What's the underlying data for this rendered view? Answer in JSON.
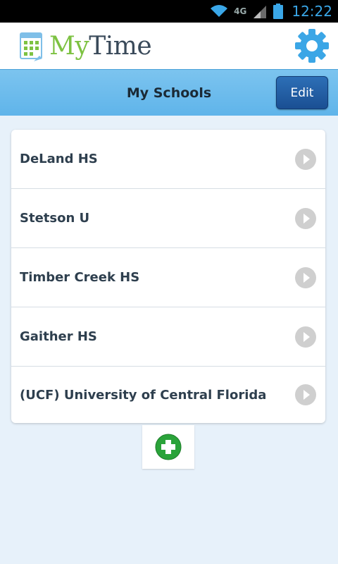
{
  "status_bar": {
    "time": "12:22",
    "network": "4G"
  },
  "app": {
    "logo_my": "My",
    "logo_time": "Time"
  },
  "title_bar": {
    "title": "My Schools",
    "edit_label": "Edit"
  },
  "schools": [
    {
      "name": "DeLand HS"
    },
    {
      "name": "Stetson U"
    },
    {
      "name": "Timber Creek HS"
    },
    {
      "name": "Gaither HS"
    },
    {
      "name": "(UCF) University of Central Florida"
    }
  ],
  "colors": {
    "accent_blue": "#5fb4ea",
    "edit_button": "#1f5ea4",
    "logo_green": "#7dc242",
    "add_icon": "#2aa33a"
  },
  "icons": {
    "settings": "gear-icon",
    "row_arrow": "chevron-right-circle-icon",
    "add": "plus-circle-icon"
  }
}
